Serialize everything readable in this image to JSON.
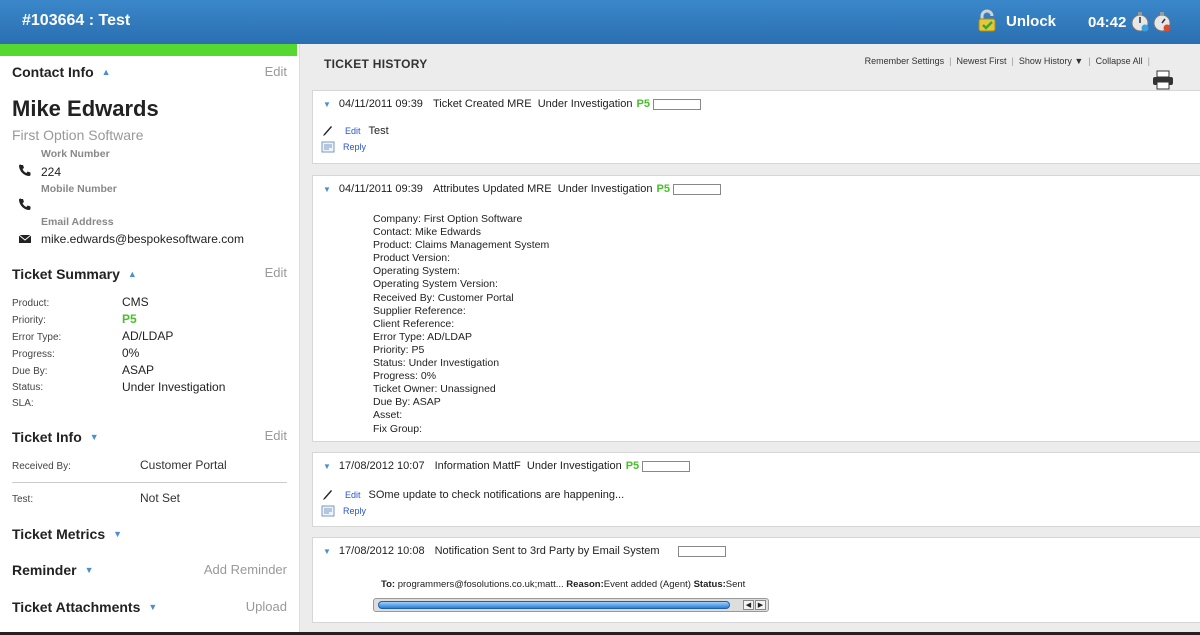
{
  "header": {
    "ticket_title": "#103664 : Test",
    "unlock_label": "Unlock",
    "timer": "04:42"
  },
  "contact": {
    "section_title": "Contact Info",
    "edit_label": "Edit",
    "name": "Mike Edwards",
    "company": "First Option Software",
    "work_label": "Work Number",
    "work_value": "224",
    "mobile_label": "Mobile Number",
    "mobile_value": "",
    "email_label": "Email Address",
    "email_value": "mike.edwards@bespokesoftware.com"
  },
  "summary": {
    "section_title": "Ticket Summary",
    "edit_label": "Edit",
    "rows": [
      {
        "label": "Product:",
        "value": "CMS"
      },
      {
        "label": "Priority:",
        "value": "P5"
      },
      {
        "label": "Error Type:",
        "value": "AD/LDAP"
      },
      {
        "label": "Progress:",
        "value": "0%"
      },
      {
        "label": "Due By:",
        "value": "ASAP"
      },
      {
        "label": "Status:",
        "value": "Under Investigation"
      },
      {
        "label": "SLA:",
        "value": ""
      }
    ],
    "priority_color": "#46c12a"
  },
  "ticket_info": {
    "section_title": "Ticket Info",
    "edit_label": "Edit",
    "received_label": "Received By:",
    "received_value": "Customer Portal",
    "test_label": "Test:",
    "test_value": "Not Set"
  },
  "metrics": {
    "section_title": "Ticket Metrics"
  },
  "reminder": {
    "section_title": "Reminder",
    "action": "Add Reminder"
  },
  "attachments": {
    "section_title": "Ticket Attachments",
    "action": "Upload"
  },
  "history": {
    "title": "TICKET HISTORY",
    "toolbar": {
      "remember": "Remember Settings",
      "newest": "Newest First",
      "show": "Show History ▼",
      "collapse": "Collapse All"
    },
    "entries": [
      {
        "datetime": "04/11/2011 09:39",
        "event": "Ticket Created",
        "user": "MRE",
        "status": "Under Investigation",
        "priority": "P5",
        "edit": "Edit",
        "note": "Test",
        "reply": "Reply"
      },
      {
        "datetime": "04/11/2011 09:39",
        "event": "Attributes Updated",
        "user": "MRE",
        "status": "Under Investigation",
        "priority": "P5",
        "attributes": [
          "Company: First Option Software",
          "Contact: Mike Edwards",
          "Product: Claims Management System",
          "Product Version:",
          "Operating System:",
          "Operating System Version:",
          "Received By: Customer Portal",
          "Supplier Reference:",
          "Client Reference:",
          "Error Type: AD/LDAP",
          "Priority: P5",
          "Status: Under Investigation",
          "Progress: 0%",
          "Ticket Owner: Unassigned",
          "Due By: ASAP",
          "Asset:",
          "Fix Group:"
        ]
      },
      {
        "datetime": "17/08/2012 10:07",
        "event": "Information",
        "user": "MattF",
        "status": "Under Investigation",
        "priority": "P5",
        "edit": "Edit",
        "note": "SOme update to check notifications are happening...",
        "reply": "Reply"
      },
      {
        "datetime": "17/08/2012 10:08",
        "event": "Notification Sent to 3rd Party by Email",
        "user": "System",
        "to_label": "To:",
        "to_value": "programmers@fosolutions.co.uk;matt...",
        "reason_label": "Reason:",
        "reason_value": "Event added (Agent)",
        "status_label": "Status:",
        "status_value": "Sent"
      }
    ]
  }
}
